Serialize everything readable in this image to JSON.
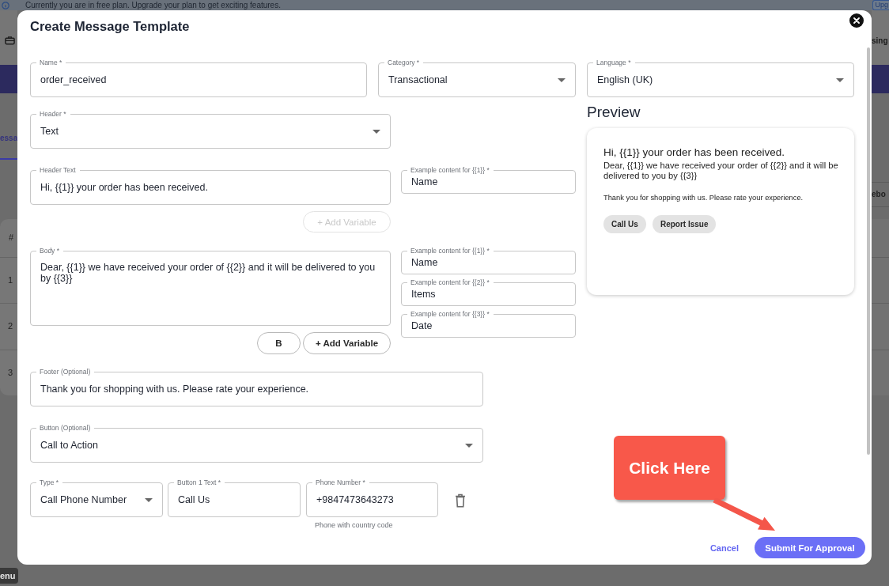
{
  "background_page": {
    "banner": {
      "text": "Currently you are in free plan. Upgrade your plan to get exciting features.",
      "button": "Upg"
    },
    "nav_text": "sing",
    "tab": {
      "label": "essa",
      "selected": true
    },
    "column_text": "ebo",
    "table": {
      "column_1": "#",
      "rows": [
        "1",
        "2",
        "3"
      ]
    },
    "menu_chip": "enu"
  },
  "dialog": {
    "title": "Create Message Template",
    "name": {
      "label": "Name *",
      "value": "order_received",
      "kind": "text"
    },
    "category": {
      "label": "Category *",
      "value": "Transactional",
      "kind": "select"
    },
    "language": {
      "label": "Language *",
      "value": "English (UK)",
      "kind": "select"
    },
    "header": {
      "label": "Header *",
      "value": "Text",
      "kind": "select"
    },
    "header_text": {
      "label": "Header Text",
      "value": "Hi, {{1}} your order has been received.",
      "kind": "text"
    },
    "header_examples": [
      {
        "label": "Example content for {{1}} *",
        "value": "Name",
        "kind": "text"
      }
    ],
    "header_add_variable": {
      "label": "+ Add Variable",
      "disabled": true
    },
    "body": {
      "label": "Body *",
      "value": "Dear, {{1}} we have received your order of {{2}} and it will be delivered to you by {{3}}",
      "kind": "textarea"
    },
    "body_examples": [
      {
        "label": "Example content for {{1}} *",
        "value": "Name",
        "kind": "text"
      },
      {
        "label": "Example content for {{2}} *",
        "value": "Items",
        "kind": "text"
      },
      {
        "label": "Example content for {{3}} *",
        "value": "Date",
        "kind": "text"
      }
    ],
    "body_buttons": [
      {
        "label": "B",
        "disabled": false
      },
      {
        "label": "+ Add Variable",
        "disabled": false
      }
    ],
    "footer": {
      "label": "Footer (Optional)",
      "value": "Thank you for shopping with us. Please rate your experience.",
      "kind": "text"
    },
    "button": {
      "label": "Button (Optional)",
      "value": "Call to Action",
      "kind": "select"
    },
    "action_fields": [
      {
        "label": "Type *",
        "value": "Call Phone Number",
        "kind": "select"
      },
      {
        "label": "Button 1 Text *",
        "value": "Call Us",
        "kind": "text"
      },
      {
        "label": "Phone Number *",
        "value": "+9847473643273",
        "kind": "text",
        "helper": "Phone with country code"
      }
    ],
    "preview": {
      "title": "Preview",
      "header": "Hi, {{1}} your order has been received.",
      "body": "Dear, {{1}} we have received your order of {{2}} and it will be delivered to you by {{3}}",
      "footer": "Thank you for shopping with us. Please rate your experience.",
      "buttons": [
        "Call Us",
        "Report Issue"
      ]
    },
    "actions": [
      {
        "label": "Cancel",
        "kind": "link"
      },
      {
        "label": "Submit For Approval",
        "kind": "primary"
      }
    ]
  },
  "callout": {
    "text": "Click Here"
  }
}
